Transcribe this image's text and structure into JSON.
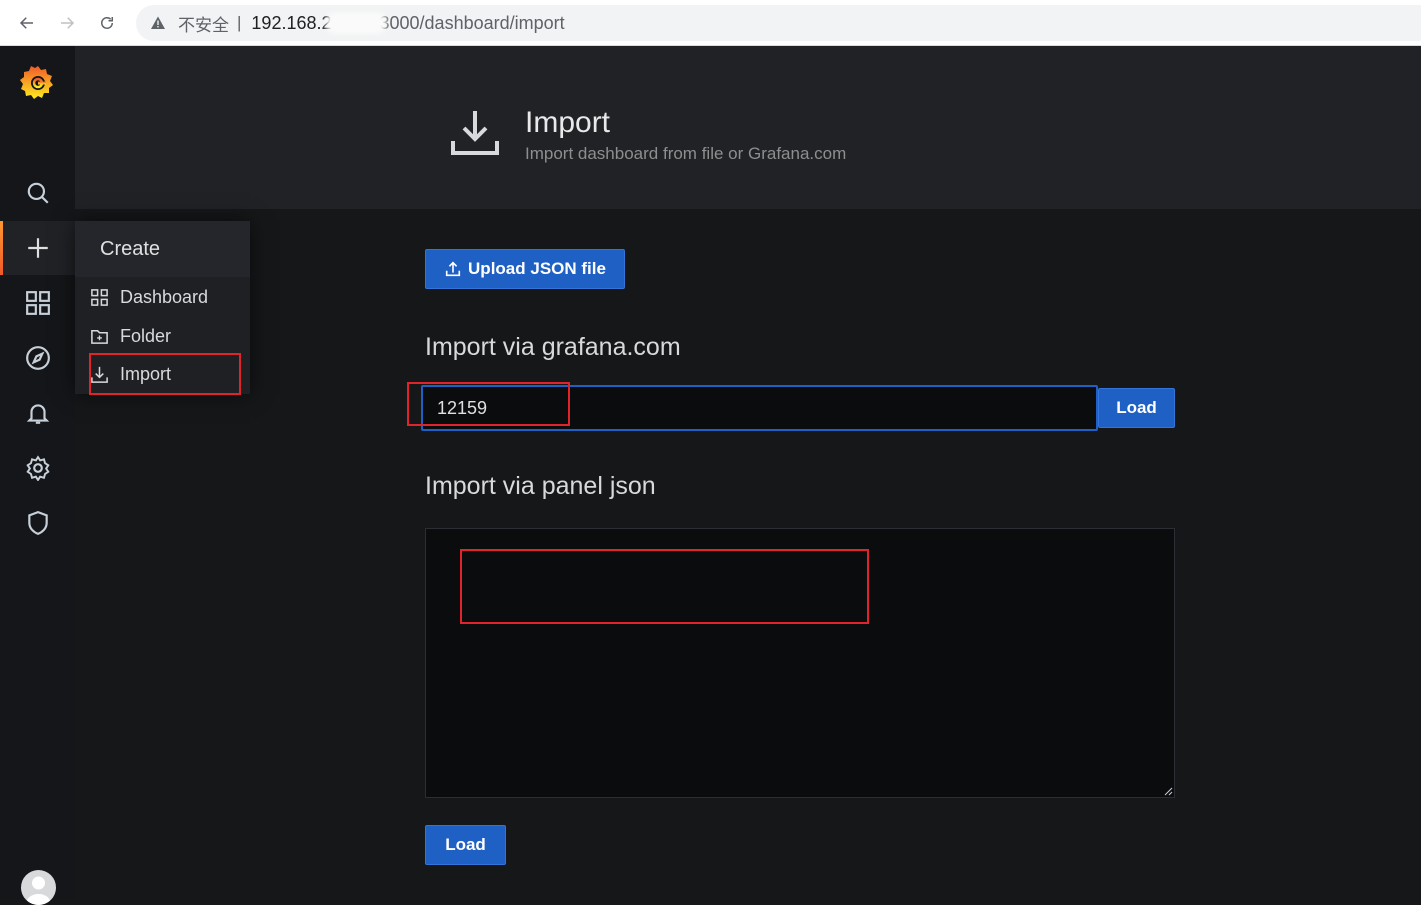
{
  "browser": {
    "insecure_label": "不安全",
    "separator": "|",
    "url_prefix": "192.168.2",
    "url_suffix": "3000/dashboard/import"
  },
  "sidebar": {
    "icons": [
      "grafana-logo",
      "search-icon",
      "plus-icon",
      "dashboards-icon",
      "explore-icon",
      "alerting-icon",
      "configuration-icon",
      "shield-icon",
      "avatar"
    ]
  },
  "create_menu": {
    "title": "Create",
    "items": [
      {
        "label": "Dashboard",
        "icon": "dashboard-icon"
      },
      {
        "label": "Folder",
        "icon": "folder-icon"
      },
      {
        "label": "Import",
        "icon": "import-icon"
      }
    ]
  },
  "page": {
    "title": "Import",
    "subtitle": "Import dashboard from file or Grafana.com"
  },
  "upload": {
    "label": "Upload JSON file"
  },
  "grafana_com": {
    "title": "Import via grafana.com",
    "input_value": "12159",
    "load_label": "Load"
  },
  "panel_json": {
    "title": "Import via panel json",
    "value": "",
    "load_label": "Load"
  },
  "colors": {
    "accent": "#1f60c4",
    "annotation": "#e0242b",
    "brand": "#f05a28"
  }
}
